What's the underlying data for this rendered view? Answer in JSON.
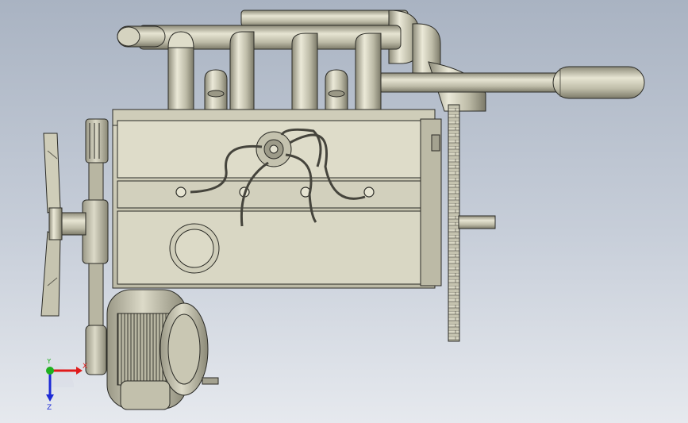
{
  "view": {
    "axes": {
      "x_label": "X",
      "y_label": "Y",
      "z_label": "Z",
      "x_color": "#e01a1a",
      "y_color": "#1fb01f",
      "z_color": "#1d2bd6"
    },
    "colors": {
      "background_top": "#a9b3c2",
      "background_bottom": "#e6e9ee",
      "metal": "#c9c7b3",
      "metal_dark": "#8e8c7a",
      "edge": "#2b2b26"
    }
  }
}
